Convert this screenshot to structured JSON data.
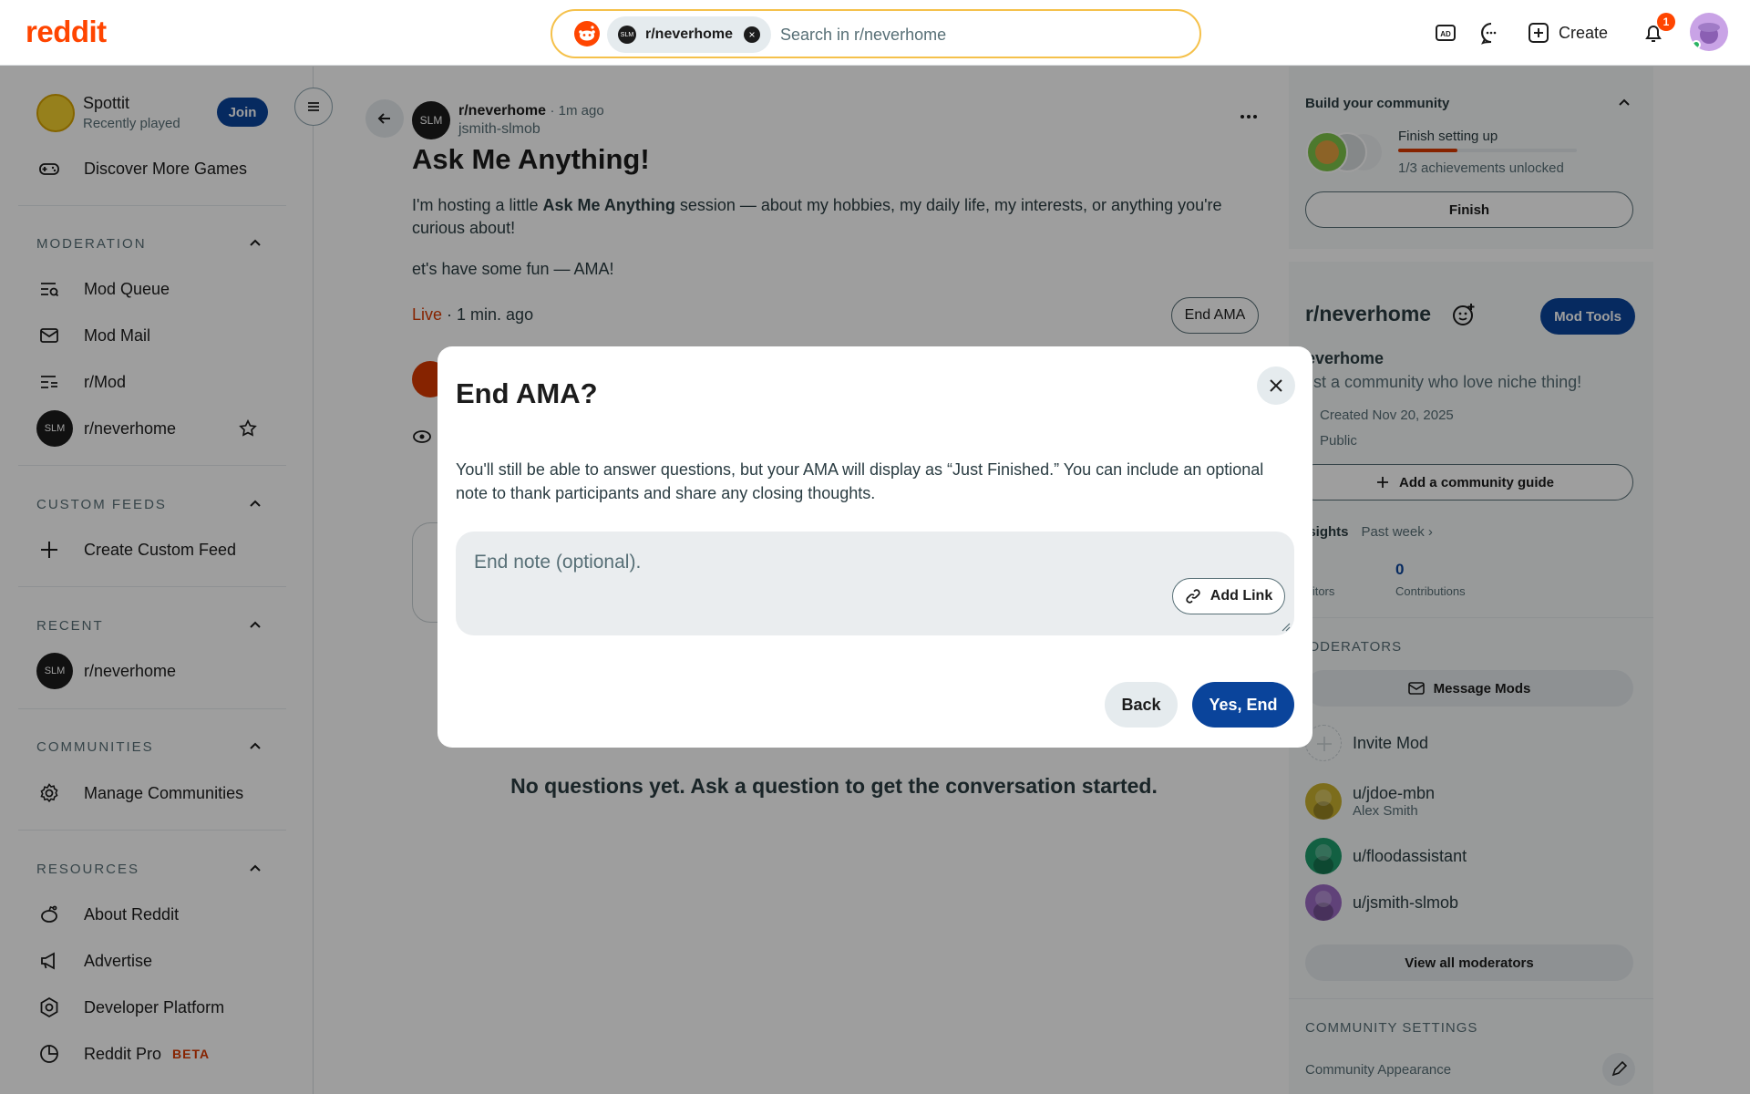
{
  "brand": {
    "logo_text": "reddit",
    "accent": "#ff4500",
    "primary_blue": "#0a449b"
  },
  "search": {
    "chip_label": "r/neverhome",
    "chip_avatar_text": "SLM",
    "placeholder": "Search in r/neverhome"
  },
  "header": {
    "create_label": "Create",
    "notification_count": "1",
    "icons": [
      "advertise-icon",
      "chat-icon",
      "create-icon",
      "bell-icon",
      "avatar"
    ]
  },
  "sidebar": {
    "game": {
      "name": "Spottit",
      "subtitle": "Recently played",
      "join_label": "Join"
    },
    "discover_label": "Discover More Games",
    "sections": {
      "moderation": "MODERATION",
      "custom_feeds": "CUSTOM FEEDS",
      "recent": "RECENT",
      "communities": "COMMUNITIES",
      "resources": "RESOURCES"
    },
    "moderation_items": [
      "Mod Queue",
      "Mod Mail",
      "r/Mod",
      "r/neverhome"
    ],
    "custom_feed_label": "Create Custom Feed",
    "recent_label": "r/neverhome",
    "manage_communities_label": "Manage Communities",
    "resources_items": [
      "About Reddit",
      "Advertise",
      "Developer Platform",
      "Reddit Pro"
    ],
    "beta_label": "BETA",
    "avatar_text": "SLM"
  },
  "post": {
    "subreddit": "r/neverhome",
    "time": "· 1m ago",
    "author": "jsmith-slmob",
    "avatar_text": "SLM",
    "title": "Ask Me Anything!",
    "body_prefix": "I'm hosting a little ",
    "body_bold": "Ask Me Anything",
    "body_suffix": " session — about my hobbies, my daily life, my interests, or anything you're curious about!",
    "body_line2": "et's have some fun — AMA!",
    "live_label": "Live",
    "live_time": " · 1 min. ago",
    "end_ama_label": "End AMA",
    "no_questions": "No questions yet. Ask a question to get the conversation started."
  },
  "right": {
    "build": {
      "title": "Build your community",
      "step_label": "Finish setting up",
      "progress": 0.33,
      "count": "1/3 achievements unlocked",
      "finish_label": "Finish"
    },
    "community": {
      "name": "r/neverhome",
      "mod_tools_label": "Mod Tools",
      "display_name": "neverhome",
      "description": "Just a community who love niche thing!",
      "created": "Created Nov 20, 2025",
      "visibility": "Public",
      "guide_label": "Add a community guide",
      "insights_label": "Insights",
      "insights_period": "Past week ›",
      "visitors_value": "0",
      "visitors_label": "Visitors",
      "contrib_value": "0",
      "contrib_label": "Contributions"
    },
    "moderators": {
      "heading": "MODERATORS",
      "message_label": "Message Mods",
      "invite_label": "Invite Mod",
      "list": [
        {
          "name": "u/jdoe-mbn",
          "sub": "Alex Smith",
          "color": "#c9b12e"
        },
        {
          "name": "u/floodassistant",
          "sub": "",
          "color": "#1e9b6b"
        },
        {
          "name": "u/jsmith-slmob",
          "sub": "",
          "color": "#9b6bc4"
        }
      ],
      "view_all_label": "View all moderators"
    },
    "settings": {
      "heading": "COMMUNITY SETTINGS",
      "appearance_label": "Community Appearance"
    }
  },
  "modal": {
    "title": "End AMA?",
    "description": "You'll still be able to answer questions, but your AMA will display as “Just Finished.” You can include an optional note to thank participants and share any closing thoughts.",
    "note_placeholder": "End note (optional).",
    "add_link_label": "Add Link",
    "back_label": "Back",
    "confirm_label": "Yes, End"
  }
}
